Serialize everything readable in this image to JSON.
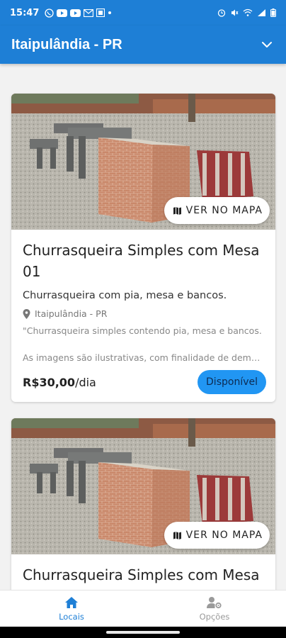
{
  "status_bar": {
    "time": "15:47",
    "left_icons": [
      "whatsapp-icon",
      "youtube-icon",
      "youtube-icon",
      "mail-icon",
      "app-icon",
      "dot-icon"
    ],
    "right_icons": [
      "alarm-icon",
      "mute-icon",
      "wifi-icon",
      "signal-icon",
      "battery-icon"
    ]
  },
  "app_bar": {
    "title": "Itaipulândia - PR",
    "dropdown_icon": "chevron-down-icon"
  },
  "listings": [
    {
      "map_button": "VER NO MAPA",
      "title": "Churrasqueira Simples com Mesa 01",
      "subtitle": "Churrasqueira com pia, mesa e bancos.",
      "location": "Itaipulândia - PR",
      "description": "\"Churrasqueira simples contendo pia, mesa e bancos.",
      "disclaimer": "As imagens são ilustrativas, com finalidade de demo...",
      "price": "R$30,00",
      "price_unit": "/dia",
      "status": "Disponível"
    },
    {
      "map_button": "VER NO MAPA",
      "title": "Churrasqueira Simples com Mesa"
    }
  ],
  "bottom_nav": {
    "items": [
      {
        "label": "Locais",
        "icon": "home-icon",
        "active": true
      },
      {
        "label": "Opções",
        "icon": "user-settings-icon",
        "active": false
      }
    ]
  },
  "colors": {
    "primary": "#1e7fd6",
    "badge": "#2196f3",
    "background": "#f2f2f2"
  }
}
